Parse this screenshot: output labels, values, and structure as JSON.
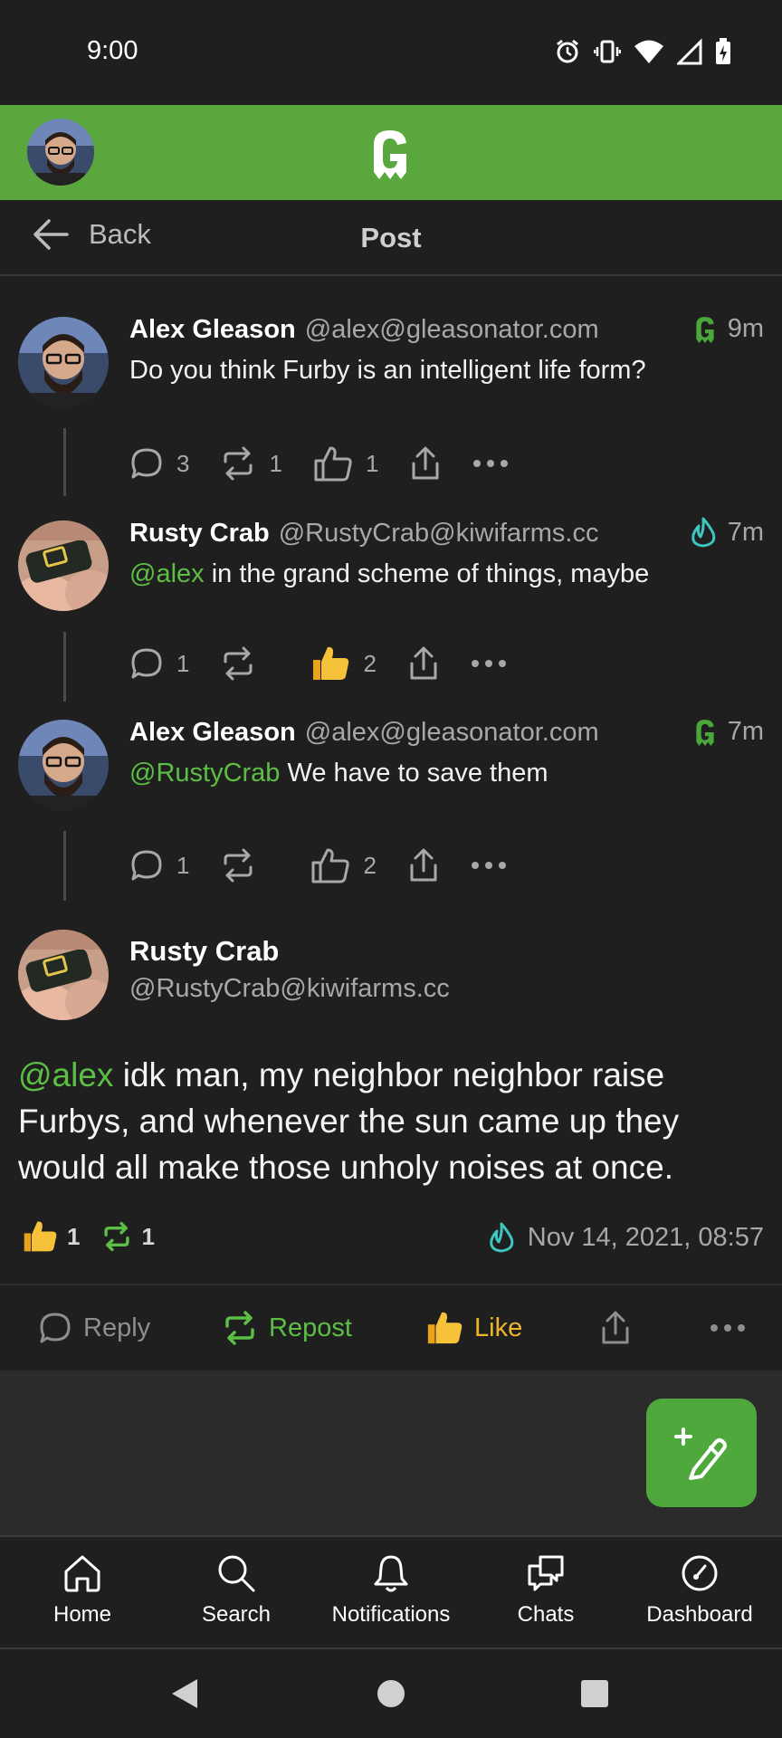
{
  "status_bar": {
    "time": "9:00"
  },
  "header": {
    "back_label": "Back",
    "title": "Post"
  },
  "thread": [
    {
      "name": "Alex Gleason",
      "handle": "@alex@gleasonator.com",
      "time": "9m",
      "mention": "",
      "text": "Do you think Furby is an intelligent life form?",
      "replies": "3",
      "reposts": "1",
      "likes": "1"
    },
    {
      "name": "Rusty Crab",
      "handle": "@RustyCrab@kiwifarms.cc",
      "time": "7m",
      "mention": "@alex",
      "text": " in the grand scheme of things, maybe",
      "replies": "1",
      "reposts": "",
      "likes": "2"
    },
    {
      "name": "Alex Gleason",
      "handle": "@alex@gleasonator.com",
      "time": "7m",
      "mention": "@RustyCrab",
      "text": " We have to save them",
      "replies": "1",
      "reposts": "",
      "likes": "2"
    }
  ],
  "focused": {
    "name": "Rusty Crab",
    "handle": "@RustyCrab@kiwifarms.cc",
    "mention": "@alex",
    "text": " idk man, my neighbor neighbor raise Furbys, and whenever the sun came up they would all make those unholy noises at once.",
    "like_count": "1",
    "repost_count": "1",
    "date": "Nov 14, 2021, 08:57"
  },
  "actions": {
    "reply": "Reply",
    "repost": "Repost",
    "like": "Like"
  },
  "tabs": [
    {
      "label": "Home"
    },
    {
      "label": "Search"
    },
    {
      "label": "Notifications"
    },
    {
      "label": "Chats"
    },
    {
      "label": "Dashboard"
    }
  ],
  "colors": {
    "brand": "#5aa83d",
    "mention": "#5cbf44",
    "like": "#f0b429",
    "kiwi": "#3ec6c0"
  }
}
